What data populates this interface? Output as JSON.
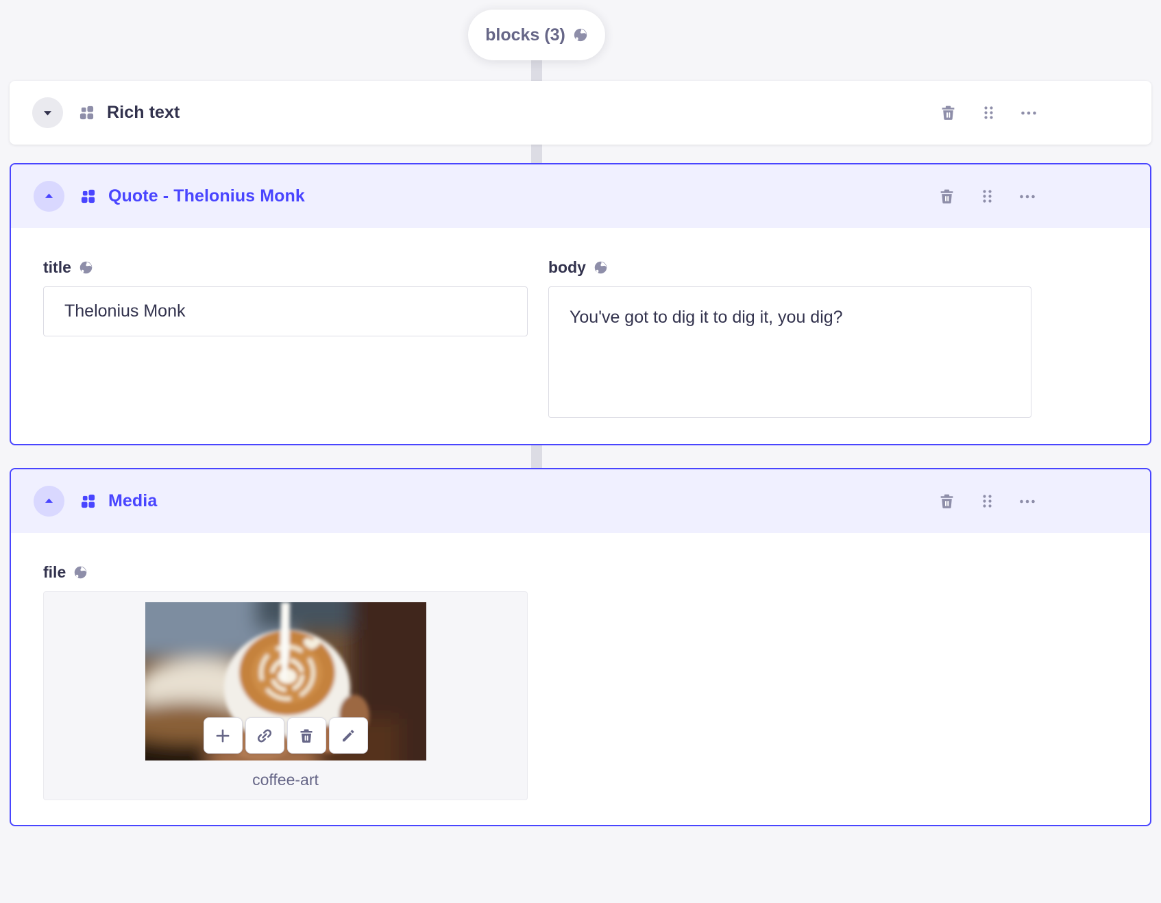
{
  "zone_pill": {
    "label": "blocks (3)"
  },
  "blocks": [
    {
      "label": "Rich text",
      "state": "collapsed"
    },
    {
      "label": "Quote - Thelonius Monk",
      "state": "expanded",
      "fields": {
        "title": {
          "label": "title",
          "value": "Thelonius Monk"
        },
        "body": {
          "label": "body",
          "value": "You've got to dig it to dig it, you dig?"
        }
      }
    },
    {
      "label": "Media",
      "state": "expanded",
      "fields": {
        "file": {
          "label": "file",
          "media_name": "coffee-art"
        }
      }
    }
  ],
  "colors": {
    "accent": "#4945ff",
    "accent_bg": "#f0f0ff",
    "accent_circle": "#d9d8ff",
    "page_bg": "#f6f6f9",
    "icon_gray": "#8e8ea9",
    "text_dark": "#32324d",
    "text_gray": "#666687",
    "input_border": "#dcdce4"
  }
}
